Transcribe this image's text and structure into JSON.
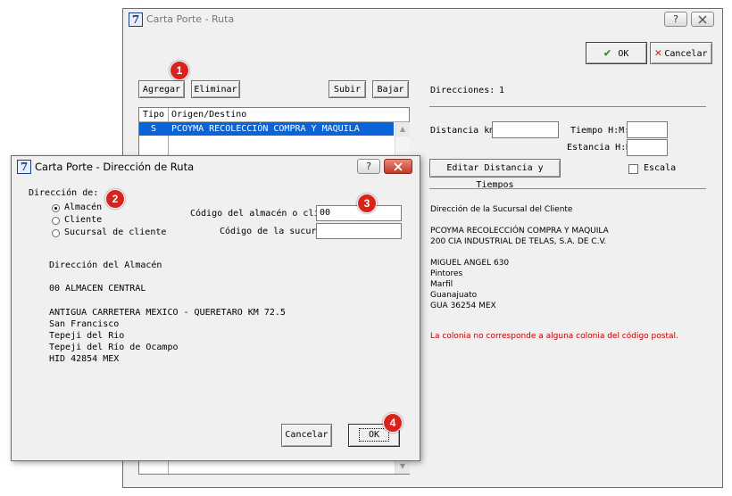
{
  "route_window": {
    "title": "Carta Porte - Ruta",
    "help_btn": "?",
    "ok_label": "OK",
    "cancel_label": "Cancelar",
    "agregar": "Agregar",
    "eliminar": "Eliminar",
    "subir": "Subir",
    "bajar": "Bajar",
    "table": {
      "headers": [
        "Tipo",
        "Origen/Destino"
      ],
      "rows": [
        {
          "tipo": "S",
          "origen": "PCOYMA  RECOLECCIÓN COMPRA Y MAQUILA"
        }
      ]
    },
    "direcciones_label": "Direcciones:",
    "direcciones_count": "1",
    "distancia_label": "Distancia km:",
    "tiempo_label": "Tiempo H:M:",
    "estancia_label": "Estancia H:M:",
    "editar_btn": "Editar Distancia y Tiempos",
    "escala_label": "Escala",
    "sucursal_heading": "Dirección de la Sucursal del Cliente",
    "sucursal_lines": [
      "PCOYMA  RECOLECCIÓN COMPRA Y MAQUILA",
      "200  CIA INDUSTRIAL DE TELAS, S.A. DE C.V.",
      "",
      "MIGUEL ANGEL 630",
      "Pintores",
      "Marfil",
      "Guanajuato",
      "GUA  36254  MEX"
    ],
    "warning": "La colonia no corresponde a alguna colonia del código postal."
  },
  "dialog": {
    "title": "Carta Porte - Dirección de Ruta",
    "help_btn": "?",
    "direccion_label": "Dirección de:",
    "options": [
      "Almacén",
      "Cliente",
      "Sucursal de cliente"
    ],
    "codigo_label": "Código del almacén o cliente:",
    "codigo_value": "00",
    "sucursal_label": "Código de la sucursal:",
    "sucursal_value": "",
    "address_heading": "Dirección del Almacén",
    "almacen_line": "00  ALMACEN CENTRAL",
    "address_lines": [
      "ANTIGUA CARRETERA MEXICO - QUERETARO KM 72.5",
      "San Francisco",
      "Tepeji del Rio",
      "Tepeji del Río de Ocampo",
      "HID  42854  MEX"
    ],
    "cancelar": "Cancelar",
    "ok": "OK"
  },
  "badges": [
    "1",
    "2",
    "3",
    "4"
  ],
  "colors": {
    "accent": "#0a64d8",
    "badge": "#d8231c",
    "warning": "#c00000",
    "ok_check": "#2a8a1e",
    "cancel_x": "#c02020"
  }
}
